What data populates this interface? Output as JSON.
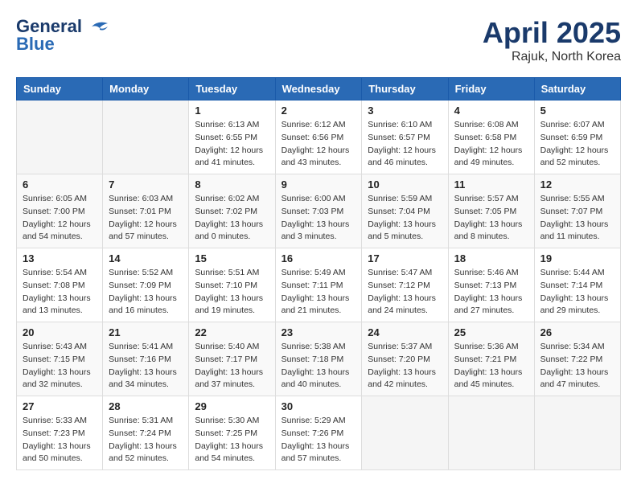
{
  "header": {
    "logo_line1": "General",
    "logo_line2": "Blue",
    "month": "April 2025",
    "location": "Rajuk, North Korea"
  },
  "weekdays": [
    "Sunday",
    "Monday",
    "Tuesday",
    "Wednesday",
    "Thursday",
    "Friday",
    "Saturday"
  ],
  "weeks": [
    [
      {
        "day": "",
        "info": ""
      },
      {
        "day": "",
        "info": ""
      },
      {
        "day": "1",
        "info": "Sunrise: 6:13 AM\nSunset: 6:55 PM\nDaylight: 12 hours\nand 41 minutes."
      },
      {
        "day": "2",
        "info": "Sunrise: 6:12 AM\nSunset: 6:56 PM\nDaylight: 12 hours\nand 43 minutes."
      },
      {
        "day": "3",
        "info": "Sunrise: 6:10 AM\nSunset: 6:57 PM\nDaylight: 12 hours\nand 46 minutes."
      },
      {
        "day": "4",
        "info": "Sunrise: 6:08 AM\nSunset: 6:58 PM\nDaylight: 12 hours\nand 49 minutes."
      },
      {
        "day": "5",
        "info": "Sunrise: 6:07 AM\nSunset: 6:59 PM\nDaylight: 12 hours\nand 52 minutes."
      }
    ],
    [
      {
        "day": "6",
        "info": "Sunrise: 6:05 AM\nSunset: 7:00 PM\nDaylight: 12 hours\nand 54 minutes."
      },
      {
        "day": "7",
        "info": "Sunrise: 6:03 AM\nSunset: 7:01 PM\nDaylight: 12 hours\nand 57 minutes."
      },
      {
        "day": "8",
        "info": "Sunrise: 6:02 AM\nSunset: 7:02 PM\nDaylight: 13 hours\nand 0 minutes."
      },
      {
        "day": "9",
        "info": "Sunrise: 6:00 AM\nSunset: 7:03 PM\nDaylight: 13 hours\nand 3 minutes."
      },
      {
        "day": "10",
        "info": "Sunrise: 5:59 AM\nSunset: 7:04 PM\nDaylight: 13 hours\nand 5 minutes."
      },
      {
        "day": "11",
        "info": "Sunrise: 5:57 AM\nSunset: 7:05 PM\nDaylight: 13 hours\nand 8 minutes."
      },
      {
        "day": "12",
        "info": "Sunrise: 5:55 AM\nSunset: 7:07 PM\nDaylight: 13 hours\nand 11 minutes."
      }
    ],
    [
      {
        "day": "13",
        "info": "Sunrise: 5:54 AM\nSunset: 7:08 PM\nDaylight: 13 hours\nand 13 minutes."
      },
      {
        "day": "14",
        "info": "Sunrise: 5:52 AM\nSunset: 7:09 PM\nDaylight: 13 hours\nand 16 minutes."
      },
      {
        "day": "15",
        "info": "Sunrise: 5:51 AM\nSunset: 7:10 PM\nDaylight: 13 hours\nand 19 minutes."
      },
      {
        "day": "16",
        "info": "Sunrise: 5:49 AM\nSunset: 7:11 PM\nDaylight: 13 hours\nand 21 minutes."
      },
      {
        "day": "17",
        "info": "Sunrise: 5:47 AM\nSunset: 7:12 PM\nDaylight: 13 hours\nand 24 minutes."
      },
      {
        "day": "18",
        "info": "Sunrise: 5:46 AM\nSunset: 7:13 PM\nDaylight: 13 hours\nand 27 minutes."
      },
      {
        "day": "19",
        "info": "Sunrise: 5:44 AM\nSunset: 7:14 PM\nDaylight: 13 hours\nand 29 minutes."
      }
    ],
    [
      {
        "day": "20",
        "info": "Sunrise: 5:43 AM\nSunset: 7:15 PM\nDaylight: 13 hours\nand 32 minutes."
      },
      {
        "day": "21",
        "info": "Sunrise: 5:41 AM\nSunset: 7:16 PM\nDaylight: 13 hours\nand 34 minutes."
      },
      {
        "day": "22",
        "info": "Sunrise: 5:40 AM\nSunset: 7:17 PM\nDaylight: 13 hours\nand 37 minutes."
      },
      {
        "day": "23",
        "info": "Sunrise: 5:38 AM\nSunset: 7:18 PM\nDaylight: 13 hours\nand 40 minutes."
      },
      {
        "day": "24",
        "info": "Sunrise: 5:37 AM\nSunset: 7:20 PM\nDaylight: 13 hours\nand 42 minutes."
      },
      {
        "day": "25",
        "info": "Sunrise: 5:36 AM\nSunset: 7:21 PM\nDaylight: 13 hours\nand 45 minutes."
      },
      {
        "day": "26",
        "info": "Sunrise: 5:34 AM\nSunset: 7:22 PM\nDaylight: 13 hours\nand 47 minutes."
      }
    ],
    [
      {
        "day": "27",
        "info": "Sunrise: 5:33 AM\nSunset: 7:23 PM\nDaylight: 13 hours\nand 50 minutes."
      },
      {
        "day": "28",
        "info": "Sunrise: 5:31 AM\nSunset: 7:24 PM\nDaylight: 13 hours\nand 52 minutes."
      },
      {
        "day": "29",
        "info": "Sunrise: 5:30 AM\nSunset: 7:25 PM\nDaylight: 13 hours\nand 54 minutes."
      },
      {
        "day": "30",
        "info": "Sunrise: 5:29 AM\nSunset: 7:26 PM\nDaylight: 13 hours\nand 57 minutes."
      },
      {
        "day": "",
        "info": ""
      },
      {
        "day": "",
        "info": ""
      },
      {
        "day": "",
        "info": ""
      }
    ]
  ]
}
